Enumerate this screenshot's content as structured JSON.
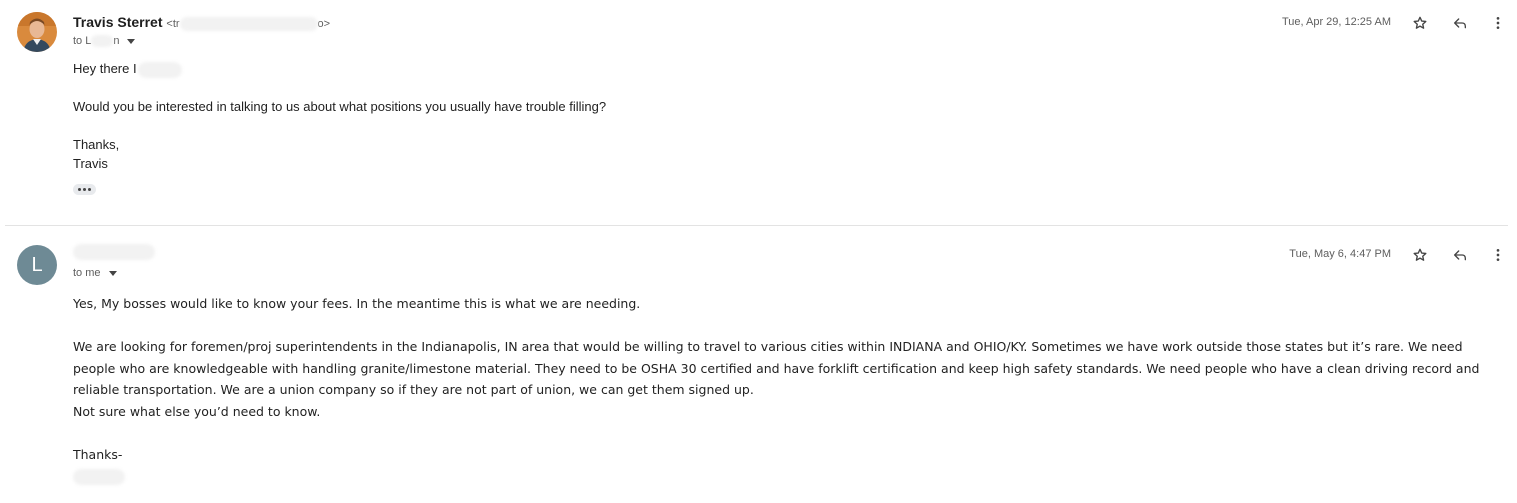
{
  "messages": [
    {
      "sender_name": "Travis Sterret",
      "sender_email_prefix": "<tr",
      "sender_email_suffix": "o>",
      "to_prefix": "to L",
      "to_suffix": "n",
      "date": "Tue, Apr 29, 12:25 AM",
      "greeting": "Hey there I",
      "body": [
        "Would you be interested in talking to us about what positions you usually have trouble filling?"
      ],
      "signoff": [
        "Thanks,",
        "Travis"
      ]
    },
    {
      "avatar_letter": "L",
      "to": "to me",
      "date": "Tue, May 6, 4:47 PM",
      "paragraph1": "Yes, My bosses would like to know your fees. In the meantime this is what we are needing.",
      "paragraph2": "We are looking for foremen/proj superintendents in the Indianapolis, IN area that would be willing to travel to various cities within INDIANA and OHIO/KY.  Sometimes we have work outside those states but it’s rare. We need people who are knowledgeable with handling granite/limestone material. They need to be OSHA 30 certified and have forklift certification and keep high safety standards. We need people who have a clean driving record and reliable transportation.  We are a union company so if they are not part of union, we can get them signed up.",
      "paragraph3": "Not sure what else you’d need to know.",
      "signoff": "Thanks-"
    }
  ],
  "icons": {
    "star": "star-icon",
    "reply": "reply-icon",
    "more": "more-vert-icon",
    "caret": "chevron-down-icon",
    "trimmed": "more-horiz-icon"
  },
  "colors": {
    "avatar_l_bg": "#6e8a95",
    "text": "#222222",
    "muted": "#5e5e5e"
  }
}
